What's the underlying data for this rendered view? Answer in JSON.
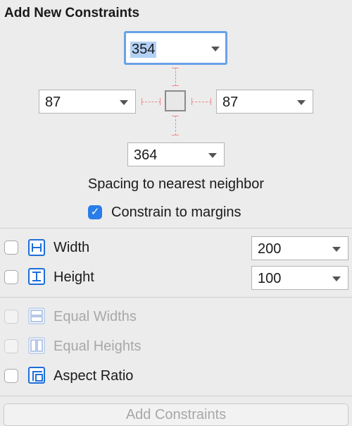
{
  "panel": {
    "title": "Add New Constraints"
  },
  "spacing": {
    "top": "354",
    "left": "87",
    "right": "87",
    "bottom": "364",
    "caption": "Spacing to nearest neighbor"
  },
  "constrain_margins": {
    "label": "Constrain to margins",
    "checked": true
  },
  "size": {
    "width": {
      "label": "Width",
      "value": "200",
      "checked": false
    },
    "height": {
      "label": "Height",
      "value": "100",
      "checked": false
    }
  },
  "equal": {
    "widths": {
      "label": "Equal Widths",
      "enabled": false
    },
    "heights": {
      "label": "Equal Heights",
      "enabled": false
    }
  },
  "aspect_ratio": {
    "label": "Aspect Ratio",
    "checked": false
  },
  "footer": {
    "add_button": "Add Constraints",
    "enabled": false
  },
  "colors": {
    "accent": "#2a7ce8",
    "strut": "#f08a8a",
    "focus": "#6aa1e8"
  }
}
